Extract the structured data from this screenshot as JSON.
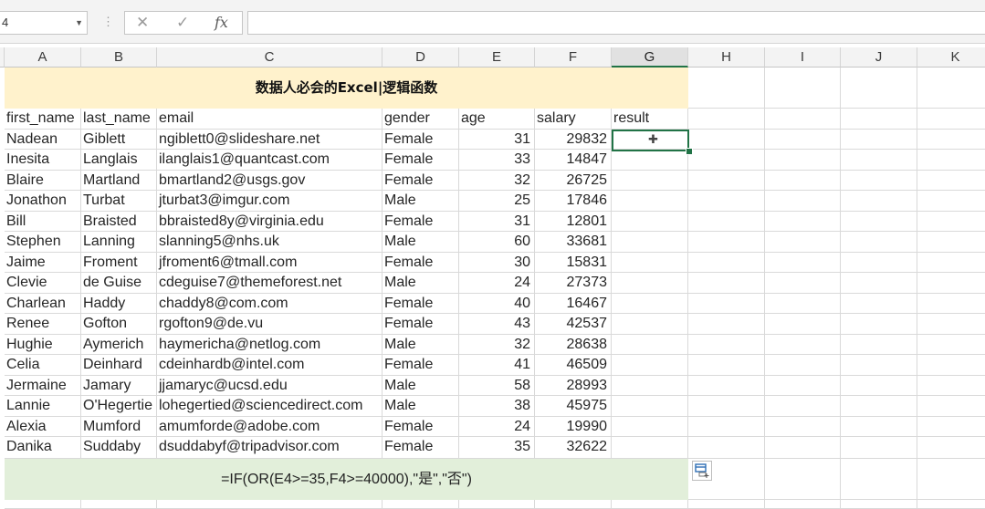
{
  "formula_bar": {
    "name_box": "4",
    "cancel_icon": "✕",
    "enter_icon": "✓",
    "fx_label": "fx",
    "formula": ""
  },
  "columns": [
    "A",
    "B",
    "C",
    "D",
    "E",
    "F",
    "G",
    "H",
    "I",
    "J",
    "K"
  ],
  "selected_column": "G",
  "title": "数据人必会的Excel|逻辑函数",
  "headers": [
    "first_name",
    "last_name",
    "email",
    "gender",
    "age",
    "salary",
    "result"
  ],
  "rows": [
    [
      "Nadean",
      "Giblett",
      "ngiblett0@slideshare.net",
      "Female",
      "31",
      "29832"
    ],
    [
      "Inesita",
      "Langlais",
      "ilanglais1@quantcast.com",
      "Female",
      "33",
      "14847"
    ],
    [
      "Blaire",
      "Martland",
      "bmartland2@usgs.gov",
      "Female",
      "32",
      "26725"
    ],
    [
      "Jonathon",
      "Turbat",
      "jturbat3@imgur.com",
      "Male",
      "25",
      "17846"
    ],
    [
      "Bill",
      "Braisted",
      "bbraisted8y@virginia.edu",
      "Female",
      "31",
      "12801"
    ],
    [
      "Stephen",
      "Lanning",
      "slanning5@nhs.uk",
      "Male",
      "60",
      "33681"
    ],
    [
      "Jaime",
      "Froment",
      "jfroment6@tmall.com",
      "Female",
      "30",
      "15831"
    ],
    [
      "Clevie",
      "de Guise",
      "cdeguise7@themeforest.net",
      "Male",
      "24",
      "27373"
    ],
    [
      "Charlean",
      "Haddy",
      "chaddy8@com.com",
      "Female",
      "40",
      "16467"
    ],
    [
      "Renee",
      "Gofton",
      "rgofton9@de.vu",
      "Female",
      "43",
      "42537"
    ],
    [
      "Hughie",
      "Aymerich",
      "haymericha@netlog.com",
      "Male",
      "32",
      "28638"
    ],
    [
      "Celia",
      "Deinhard",
      "cdeinhardb@intel.com",
      "Female",
      "41",
      "46509"
    ],
    [
      "Jermaine",
      "Jamary",
      "jjamaryc@ucsd.edu",
      "Male",
      "58",
      "28993"
    ],
    [
      "Lannie",
      "O'Hegertie",
      "lohegertied@sciencedirect.com",
      "Male",
      "38",
      "45975"
    ],
    [
      "Alexia",
      "Mumford",
      "amumforde@adobe.com",
      "Female",
      "24",
      "19990"
    ],
    [
      "Danika",
      "Suddaby",
      "dsuddabyf@tripadvisor.com",
      "Female",
      "35",
      "32622"
    ]
  ],
  "footer_formula": "=IF(OR(E4>=35,F4>=40000),\"是\",\"否\")"
}
